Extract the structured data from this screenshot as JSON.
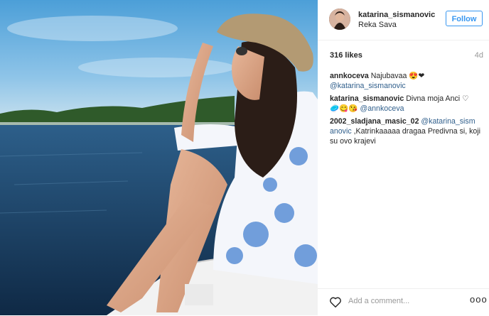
{
  "post": {
    "username": "katarina_sismanovic",
    "location": "Reka Sava",
    "follow_label": "Follow",
    "likes": "316 likes",
    "age": "4d"
  },
  "comments": [
    {
      "user": "annkoceva",
      "text": "Najubavaa 😍❤",
      "mention": "@katarina_sismanovic"
    },
    {
      "user": "katarina_sismanovic",
      "text": "Divna moja Anci ♡",
      "text2": "🥏😋😘 ",
      "mention": "@annkoceva"
    },
    {
      "user": "2002_sladjana_masic_02",
      "mention": "@katarina_sism anovic",
      "text": " ,Katrinkaaaaa dragaa Predivna si, koji su ovo krajevi"
    }
  ],
  "footer": {
    "add_comment_placeholder": "Add a comment...",
    "more": "ooo"
  },
  "icons": {
    "heart": "heart-outline-icon",
    "more": "more-options-icon"
  },
  "colors": {
    "follow_blue": "#3897f0",
    "mention": "#2f5e8b",
    "muted": "#999999"
  }
}
